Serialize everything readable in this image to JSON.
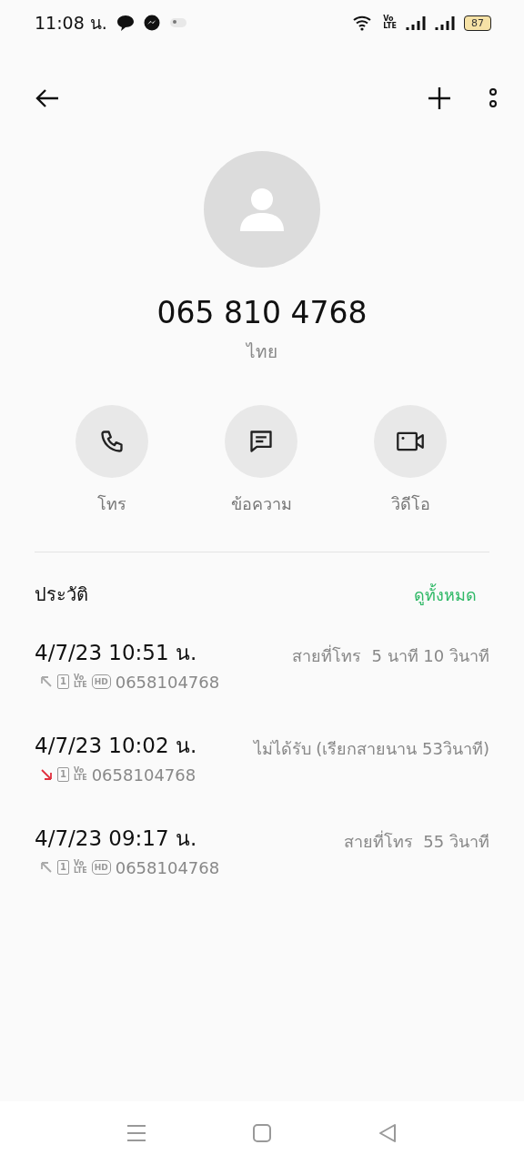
{
  "status_bar": {
    "time": "11:08 น.",
    "volte": [
      "Vo",
      "LTE"
    ],
    "battery": "87"
  },
  "contact": {
    "number": "065 810 4768",
    "location": "ไทย"
  },
  "actions": [
    {
      "kind": "call",
      "label": "โทร"
    },
    {
      "kind": "message",
      "label": "ข้อความ"
    },
    {
      "kind": "video",
      "label": "วิดีโอ"
    }
  ],
  "history": {
    "title": "ประวัติ",
    "view_all": "ดูทั้งหมด",
    "calls": [
      {
        "kind": "outgoing",
        "time": "4/7/23 10:51 น.",
        "sim": "1",
        "volte": [
          "Vo",
          "LTE"
        ],
        "hd": "HD",
        "number": "0658104768",
        "detail": "สายที่โทร  5 นาที 10 วินาที"
      },
      {
        "kind": "missed",
        "time": "4/7/23 10:02 น.",
        "sim": "1",
        "volte": [
          "Vo",
          "LTE"
        ],
        "number": "0658104768",
        "detail": "ไม่ได้รับ (เรียกสายนาน 53วินาที)"
      },
      {
        "kind": "outgoing",
        "time": "4/7/23 09:17 น.",
        "sim": "1",
        "volte": [
          "Vo",
          "LTE"
        ],
        "hd": "HD",
        "number": "0658104768",
        "detail": "สายที่โทร  55 วินาที"
      }
    ]
  }
}
